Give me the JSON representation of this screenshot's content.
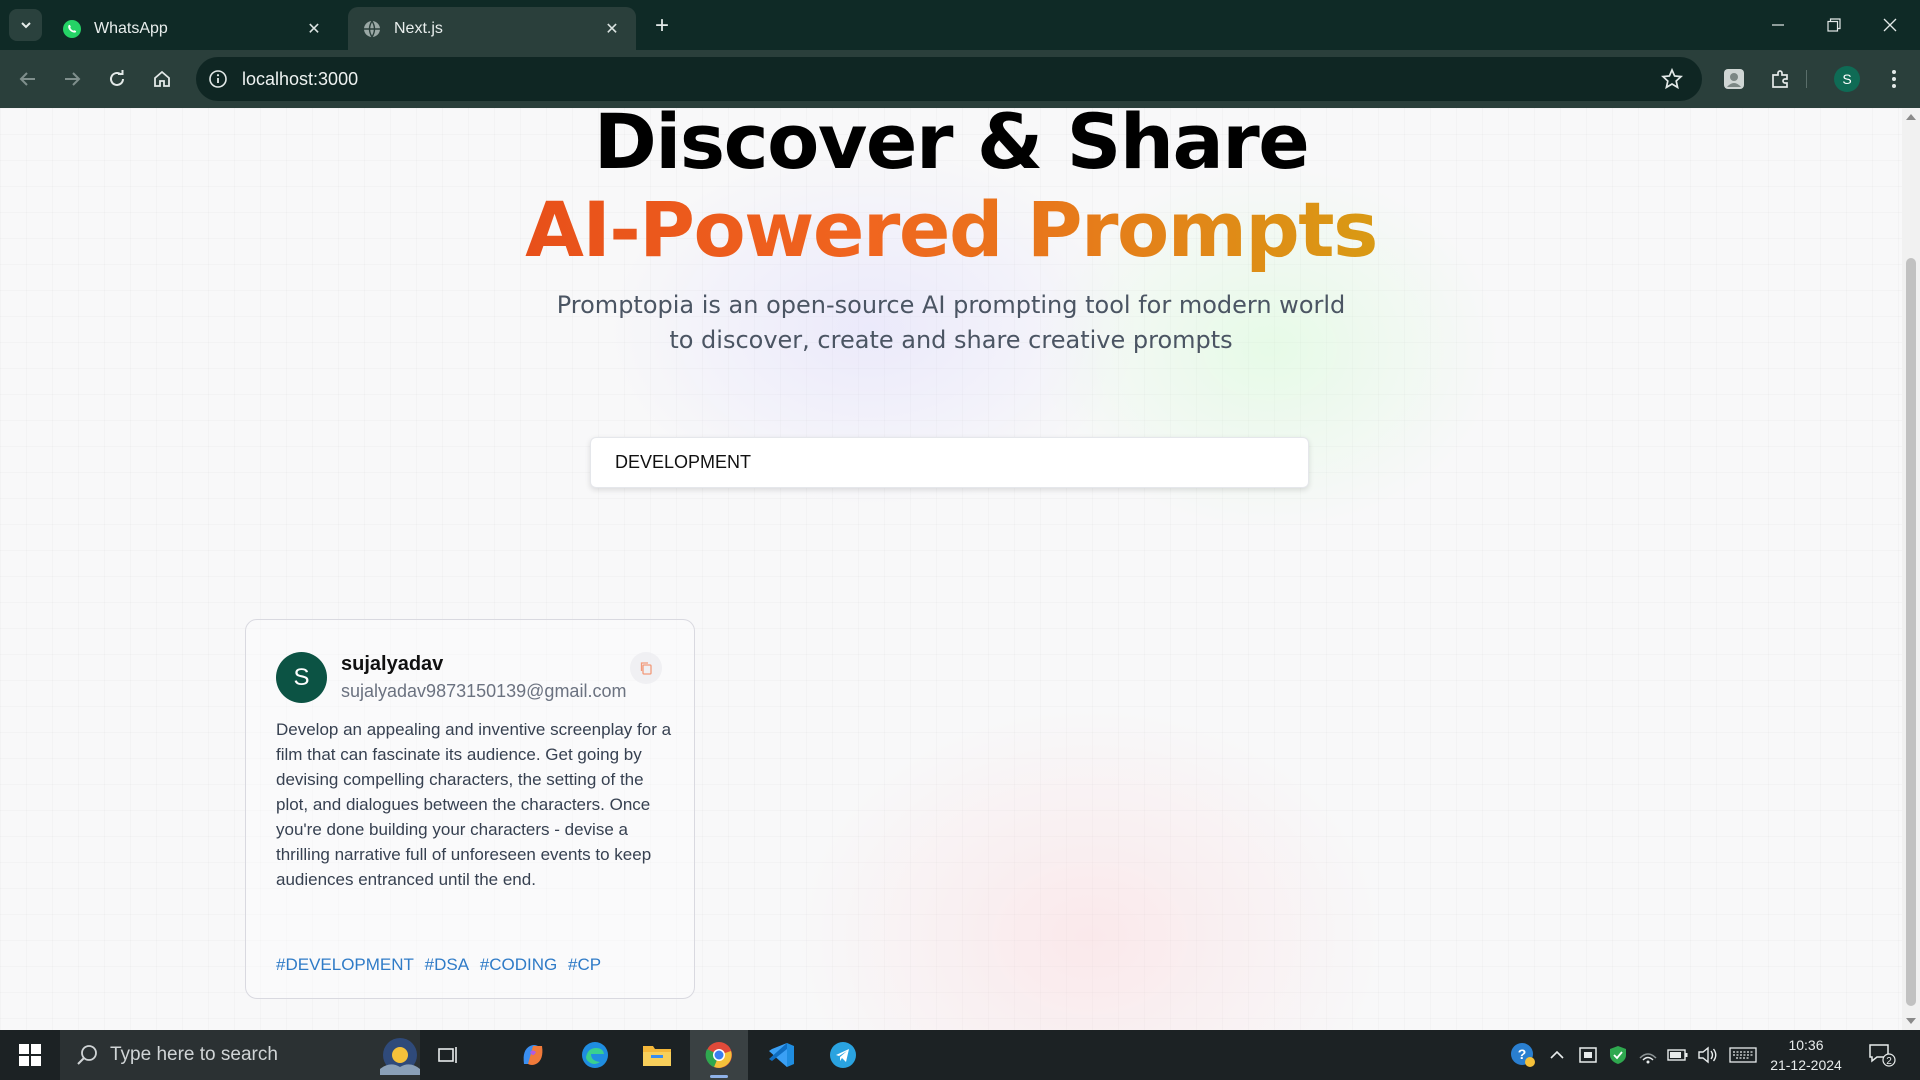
{
  "browser": {
    "tabs": [
      {
        "title": "WhatsApp",
        "icon": "whatsapp-icon",
        "active": false
      },
      {
        "title": "Next.js",
        "icon": "globe-icon",
        "active": true
      }
    ],
    "url": "localhost:3000",
    "profile_initial": "S"
  },
  "hero": {
    "line1": "Discover & Share",
    "line2": "AI-Powered Prompts",
    "description": "Promptopia is an open-source AI prompting tool for modern world to discover, create and share creative prompts"
  },
  "search": {
    "value": "DEVELOPMENT"
  },
  "card": {
    "avatar_initial": "S",
    "username": "sujalyadav",
    "email": "sujalyadav9873150139@gmail.com",
    "prompt": "Develop an appealing and inventive screenplay for a film that can fascinate its audience. Get going by devising compelling characters, the setting of the plot, and dialogues between the characters. Once you're done building your characters - devise a thrilling narrative full of unforeseen events to keep audiences entranced until the end.",
    "tags": [
      "#DEVELOPMENT",
      "#DSA",
      "#CODING",
      "#CP"
    ]
  },
  "taskbar": {
    "search_placeholder": "Type here to search",
    "time": "10:36",
    "date": "21-12-2024",
    "notification_count": "2",
    "apps": [
      "task-view-icon",
      "copilot-icon",
      "edge-icon",
      "file-explorer-icon",
      "chrome-icon",
      "vscode-icon",
      "telegram-icon"
    ]
  },
  "colors": {
    "gradient_start": "#e8501a",
    "gradient_end": "#d99a14",
    "tag_color": "#2f7bc7",
    "avatar_bg": "#0c5344"
  }
}
